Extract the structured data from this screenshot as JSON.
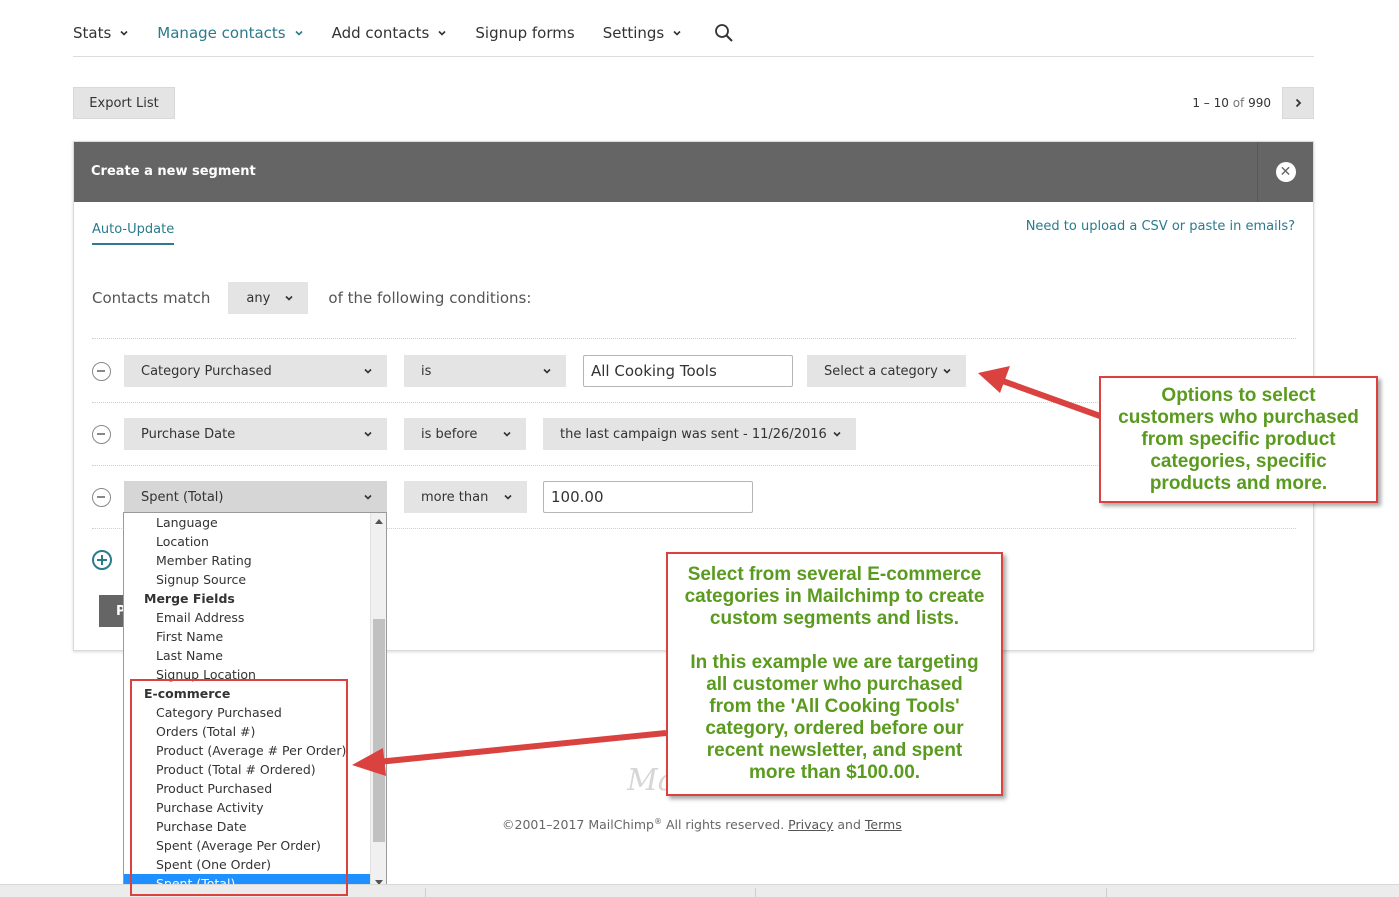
{
  "nav": {
    "items": [
      {
        "label": "Stats",
        "has_chevron": true,
        "active": false
      },
      {
        "label": "Manage contacts",
        "has_chevron": true,
        "active": true
      },
      {
        "label": "Add contacts",
        "has_chevron": true,
        "active": false
      },
      {
        "label": "Signup forms",
        "has_chevron": false,
        "active": false
      },
      {
        "label": "Settings",
        "has_chevron": true,
        "active": false
      }
    ],
    "search_icon": "search-icon"
  },
  "toolbar": {
    "export_label": "Export List",
    "pager_range": "1 – 10",
    "pager_of": "of",
    "pager_total": "990"
  },
  "segment": {
    "title": "Create a new segment",
    "tab_auto_update": "Auto-Update",
    "csv_link": "Need to upload a CSV or paste in emails?",
    "contacts_match": "Contacts match",
    "match_value": "any",
    "conditions_suffix": "of the following conditions:",
    "conditions": [
      {
        "field": "Category Purchased",
        "operator": "is",
        "value": "All Cooking Tools",
        "extra": "Select a category"
      },
      {
        "field": "Purchase Date",
        "operator": "is before",
        "value": "the last campaign was sent - 11/26/2016"
      },
      {
        "field": "Spent (Total)",
        "operator": "more than",
        "value": "100.00"
      }
    ],
    "preview_label": "P"
  },
  "dropdown": {
    "items": [
      {
        "label": "Language",
        "group": false
      },
      {
        "label": "Location",
        "group": false
      },
      {
        "label": "Member Rating",
        "group": false
      },
      {
        "label": "Signup Source",
        "group": false
      },
      {
        "label": "Merge Fields",
        "group": true
      },
      {
        "label": "Email Address",
        "group": false
      },
      {
        "label": "First Name",
        "group": false
      },
      {
        "label": "Last Name",
        "group": false
      },
      {
        "label": "Signup Location",
        "group": false
      },
      {
        "label": "E-commerce",
        "group": true
      },
      {
        "label": "Category Purchased",
        "group": false
      },
      {
        "label": "Orders (Total #)",
        "group": false
      },
      {
        "label": "Product (Average # Per Order)",
        "group": false
      },
      {
        "label": "Product (Total # Ordered)",
        "group": false
      },
      {
        "label": "Product Purchased",
        "group": false
      },
      {
        "label": "Purchase Activity",
        "group": false
      },
      {
        "label": "Purchase Date",
        "group": false
      },
      {
        "label": "Spent (Average Per Order)",
        "group": false
      },
      {
        "label": "Spent (One Order)",
        "group": false
      },
      {
        "label": "Spent (Total)",
        "group": false,
        "selected": true
      }
    ]
  },
  "footer": {
    "logo_text": "Ma",
    "copyright": "©2001–2017 MailChimp",
    "reg": "®",
    "rights": " All rights reserved. ",
    "privacy": "Privacy",
    "and": " and ",
    "terms": "Terms"
  },
  "annotations": {
    "right": [
      "Options to select",
      "customers who purchased",
      "from specific product",
      "categories, specific",
      "products and more."
    ],
    "mid_top": [
      "Select from several E-commerce",
      "categories in Mailchimp to create",
      "custom segments and lists."
    ],
    "mid_bottom": [
      "In this example we are targeting",
      "all customer who purchased",
      "from the 'All Cooking Tools'",
      "category, ordered before our",
      "recent newsletter, and spent",
      "more than $100.00."
    ],
    "color_text": "#5a9b1f",
    "color_border": "#d9423f"
  }
}
